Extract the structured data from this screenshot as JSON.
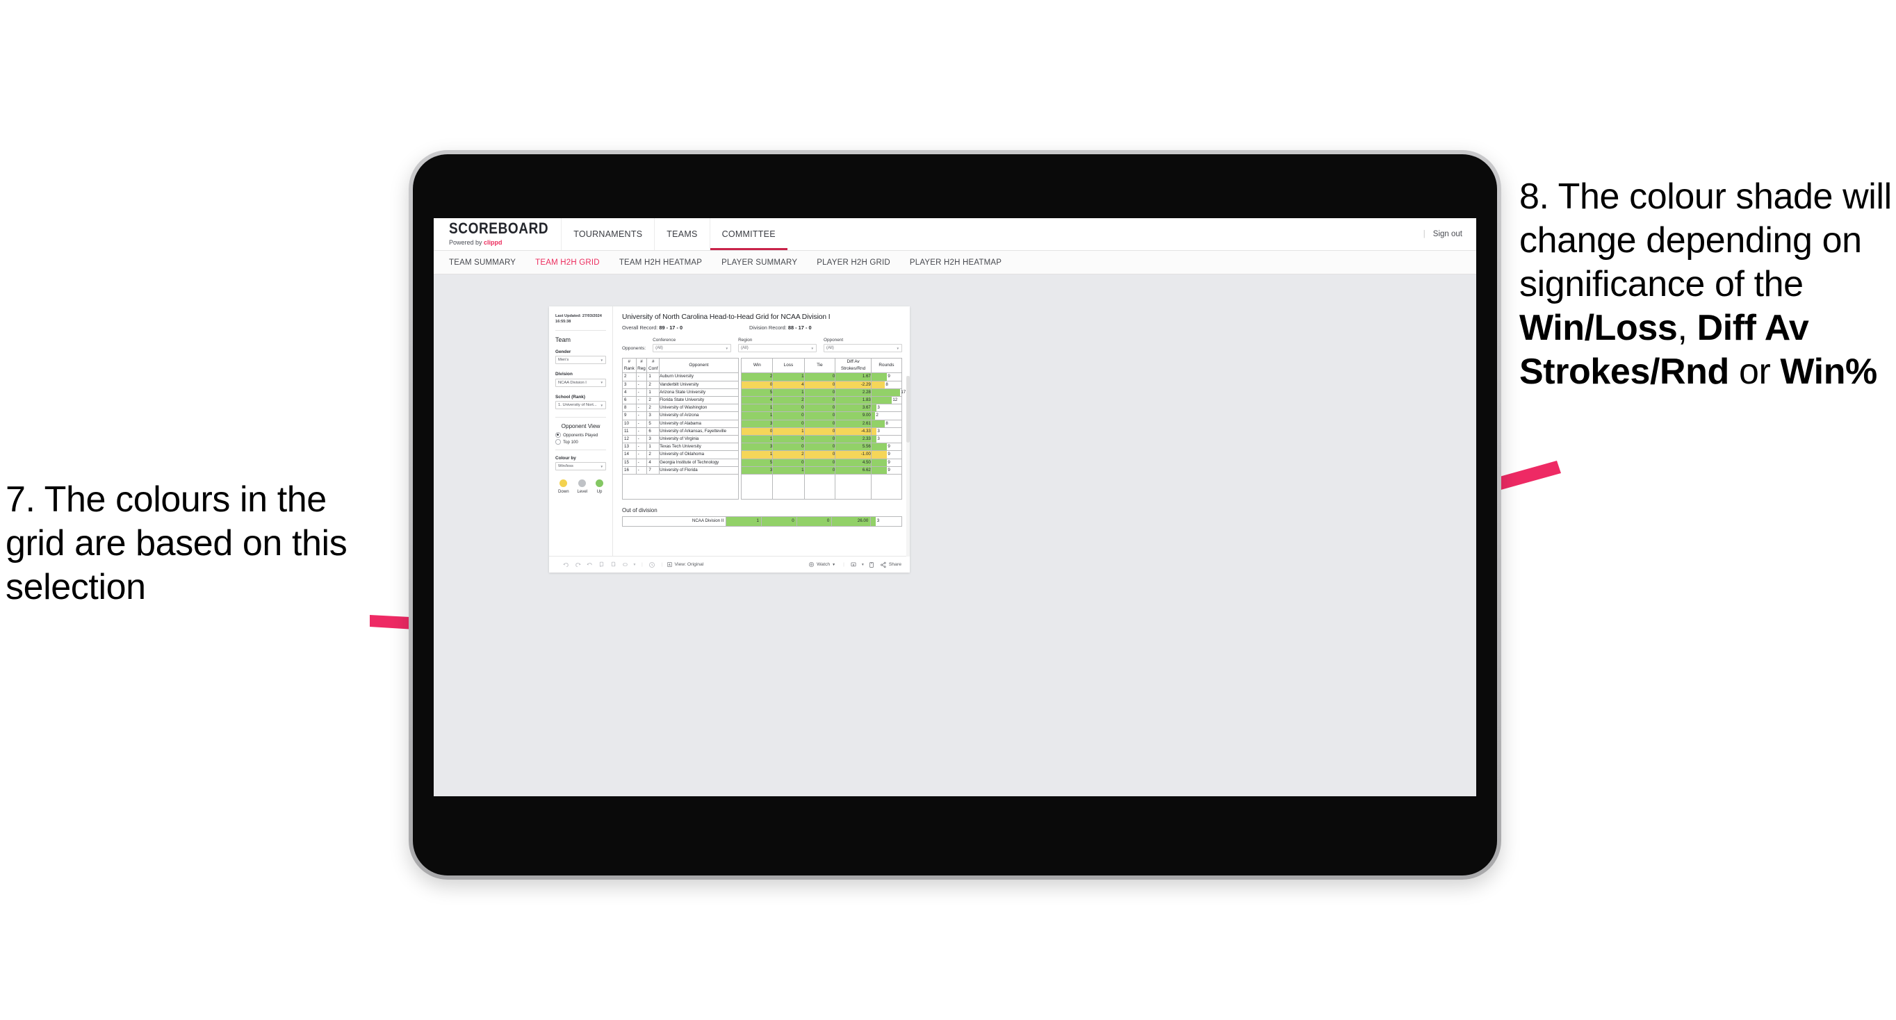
{
  "annotations": {
    "left": "7. The colours in the grid are based on this selection",
    "right_plain_1": "8. The colour shade will change depending on significance of the ",
    "right_bold_1": "Win/Loss",
    "right_plain_2": ", ",
    "right_bold_2": "Diff Av Strokes/Rnd",
    "right_plain_3": " or ",
    "right_bold_3": "Win%",
    "arrow_color": "#ee2a64"
  },
  "app": {
    "brand_title": "SCOREBOARD",
    "brand_sub_prefix": "Powered by ",
    "brand_sub_name": "clippd",
    "top_nav": [
      {
        "label": "TOURNAMENTS",
        "active": false
      },
      {
        "label": "TEAMS",
        "active": false
      },
      {
        "label": "COMMITTEE",
        "active": true
      }
    ],
    "sign_out": "Sign out",
    "sub_nav": [
      {
        "label": "TEAM SUMMARY",
        "active": false
      },
      {
        "label": "TEAM H2H GRID",
        "active": true
      },
      {
        "label": "TEAM H2H HEATMAP",
        "active": false
      },
      {
        "label": "PLAYER SUMMARY",
        "active": false
      },
      {
        "label": "PLAYER H2H GRID",
        "active": false
      },
      {
        "label": "PLAYER H2H HEATMAP",
        "active": false
      }
    ],
    "accent": "#ec2d5e"
  },
  "sidebar": {
    "last_updated_label": "Last Updated: 27/03/2024",
    "last_updated_time": "16:55:38",
    "section_team": "Team",
    "gender_label": "Gender",
    "gender_value": "Men's",
    "division_label": "Division",
    "division_value": "NCAA Division I",
    "school_label": "School (Rank)",
    "school_value": "1. University of Nort...",
    "opponent_view_label": "Opponent View",
    "radio_played": "Opponents Played",
    "radio_top100": "Top 100",
    "radio_selected": "Opponents Played",
    "colour_by_label": "Colour by",
    "colour_by_value": "Win/loss",
    "legend": [
      {
        "label": "Down",
        "color": "#f3d24f"
      },
      {
        "label": "Level",
        "color": "#bfc2c6"
      },
      {
        "label": "Up",
        "color": "#84c763"
      }
    ]
  },
  "viz": {
    "title": "University of North Carolina Head-to-Head Grid for NCAA Division I",
    "overall_label": "Overall Record:",
    "overall_value": "89 - 17 - 0",
    "division_label": "Division Record:",
    "division_value": "88 - 17 - 0",
    "opponents_label": "Opponents:",
    "filters": [
      {
        "label": "Conference",
        "value": "(All)"
      },
      {
        "label": "Region",
        "value": "(All)"
      },
      {
        "label": "Opponent",
        "value": "(All)"
      }
    ],
    "out_of_division_title": "Out of division"
  },
  "chart_data": {
    "type": "table",
    "title": "University of North Carolina Head-to-Head Grid for NCAA Division I",
    "columns": [
      "# Rank",
      "# Reg",
      "# Conf",
      "Opponent",
      "Win",
      "Loss",
      "Tie",
      "Diff Av Strokes/Rnd",
      "Rounds"
    ],
    "header_lines": {
      "rank": [
        "#",
        "Rank"
      ],
      "reg": [
        "#",
        "Reg"
      ],
      "conf": [
        "#",
        "Conf"
      ],
      "opponent": [
        "Opponent"
      ],
      "win": [
        "Win"
      ],
      "loss": [
        "Loss"
      ],
      "tie": [
        "Tie"
      ],
      "diff": [
        "Diff Av",
        "Strokes/Rnd"
      ],
      "rounds": [
        "Rounds"
      ]
    },
    "colour_by": "Win/loss",
    "rounds_max": 17,
    "rows": [
      {
        "rank": "2",
        "reg": "-",
        "conf": "1",
        "opponent": "Auburn University",
        "win": "2",
        "loss": "1",
        "tie": "0",
        "diff": "1.67",
        "rounds": "9",
        "rounds_val": 9,
        "state": "up"
      },
      {
        "rank": "3",
        "reg": "-",
        "conf": "2",
        "opponent": "Vanderbilt University",
        "win": "0",
        "loss": "4",
        "tie": "0",
        "diff": "-2.29",
        "rounds": "8",
        "rounds_val": 8,
        "state": "down"
      },
      {
        "rank": "4",
        "reg": "-",
        "conf": "1",
        "opponent": "Arizona State University",
        "win": "5",
        "loss": "1",
        "tie": "0",
        "diff": "2.28",
        "rounds": "17",
        "rounds_val": 17,
        "state": "up"
      },
      {
        "rank": "6",
        "reg": "-",
        "conf": "2",
        "opponent": "Florida State University",
        "win": "4",
        "loss": "2",
        "tie": "0",
        "diff": "1.83",
        "rounds": "12",
        "rounds_val": 12,
        "state": "up"
      },
      {
        "rank": "8",
        "reg": "-",
        "conf": "2",
        "opponent": "University of Washington",
        "win": "1",
        "loss": "0",
        "tie": "0",
        "diff": "3.67",
        "rounds": "3",
        "rounds_val": 3,
        "state": "up"
      },
      {
        "rank": "9",
        "reg": "-",
        "conf": "3",
        "opponent": "University of Arizona",
        "win": "1",
        "loss": "0",
        "tie": "0",
        "diff": "9.00",
        "rounds": "2",
        "rounds_val": 2,
        "state": "up"
      },
      {
        "rank": "10",
        "reg": "-",
        "conf": "5",
        "opponent": "University of Alabama",
        "win": "3",
        "loss": "0",
        "tie": "0",
        "diff": "2.61",
        "rounds": "8",
        "rounds_val": 8,
        "state": "up"
      },
      {
        "rank": "11",
        "reg": "-",
        "conf": "6",
        "opponent": "University of Arkansas, Fayetteville",
        "win": "0",
        "loss": "1",
        "tie": "0",
        "diff": "-4.33",
        "rounds": "3",
        "rounds_val": 3,
        "state": "down"
      },
      {
        "rank": "12",
        "reg": "-",
        "conf": "3",
        "opponent": "University of Virginia",
        "win": "1",
        "loss": "0",
        "tie": "0",
        "diff": "2.33",
        "rounds": "3",
        "rounds_val": 3,
        "state": "up"
      },
      {
        "rank": "13",
        "reg": "-",
        "conf": "1",
        "opponent": "Texas Tech University",
        "win": "3",
        "loss": "0",
        "tie": "0",
        "diff": "5.56",
        "rounds": "9",
        "rounds_val": 9,
        "state": "up"
      },
      {
        "rank": "14",
        "reg": "-",
        "conf": "2",
        "opponent": "University of Oklahoma",
        "win": "1",
        "loss": "2",
        "tie": "0",
        "diff": "-1.00",
        "rounds": "9",
        "rounds_val": 9,
        "state": "down"
      },
      {
        "rank": "15",
        "reg": "-",
        "conf": "4",
        "opponent": "Georgia Institute of Technology",
        "win": "5",
        "loss": "0",
        "tie": "0",
        "diff": "4.50",
        "rounds": "9",
        "rounds_val": 9,
        "state": "up"
      },
      {
        "rank": "16",
        "reg": "-",
        "conf": "7",
        "opponent": "University of Florida",
        "win": "3",
        "loss": "1",
        "tie": "0",
        "diff": "6.62",
        "rounds": "9",
        "rounds_val": 9,
        "state": "up"
      }
    ],
    "out_of_division": [
      {
        "name": "NCAA Division II",
        "win": "1",
        "loss": "0",
        "tie": "0",
        "diff": "26.00",
        "rounds": "3",
        "rounds_val": 3,
        "state": "up"
      }
    ],
    "colors": {
      "up": "#92d168",
      "down": "#f5d659",
      "level": "#bfc2c6"
    }
  },
  "toolbar": {
    "icons": [
      "undo-icon",
      "redo-icon",
      "revert-icon",
      "refresh-icon",
      "pause-icon",
      "filter-icon",
      "dropdown-caret-icon",
      "clock-icon"
    ],
    "view_label": "View: Original",
    "watch_label": "Watch",
    "share_label": "Share"
  }
}
